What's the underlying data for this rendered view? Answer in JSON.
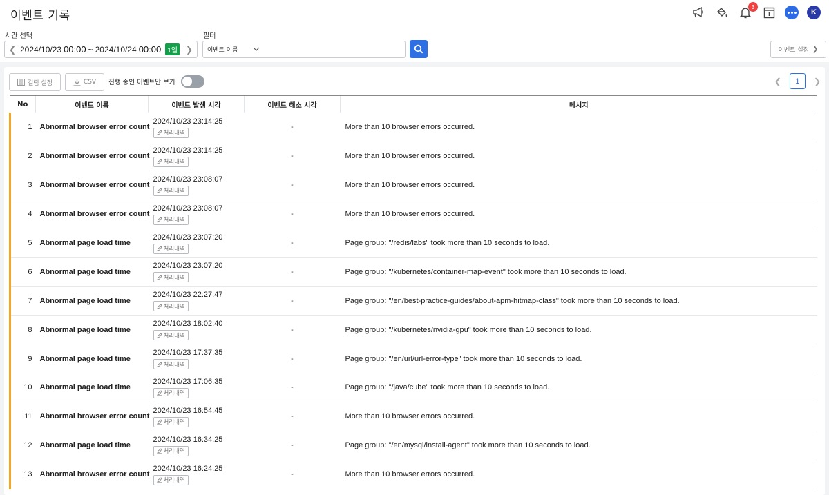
{
  "header": {
    "title": "이벤트 기록",
    "notification_count": "3",
    "avatar_letter": "K"
  },
  "filters": {
    "time_label": "시간 선택",
    "time_from_date": "2024/10/23",
    "time_from_clock": "00:00",
    "time_sep": "~",
    "time_to_date": "2024/10/24",
    "time_to_clock": "00:00",
    "time_range_badge": "1일",
    "filter_label": "필터",
    "filter_select": "이벤트 이름",
    "filter_value": "",
    "event_settings": "이벤트 설정"
  },
  "toolbar": {
    "column_settings": "컬럼 설정",
    "csv": "CSV",
    "ongoing_only": "진행 중인 이벤트만 보기",
    "ongoing_toggle_on": false
  },
  "pagination": {
    "current_page": "1"
  },
  "table": {
    "columns": [
      "No",
      "이벤트 이름",
      "이벤트 발생 시각",
      "이벤트 해소 시각",
      "메시지"
    ],
    "history_button": "처리내역",
    "rows": [
      {
        "no": "1",
        "name": "Abnormal browser error count",
        "occurred": "2024/10/23 23:14:25",
        "resolved": "-",
        "message": "More than 10 browser errors occurred."
      },
      {
        "no": "2",
        "name": "Abnormal browser error count",
        "occurred": "2024/10/23 23:14:25",
        "resolved": "-",
        "message": "More than 10 browser errors occurred."
      },
      {
        "no": "3",
        "name": "Abnormal browser error count",
        "occurred": "2024/10/23 23:08:07",
        "resolved": "-",
        "message": "More than 10 browser errors occurred."
      },
      {
        "no": "4",
        "name": "Abnormal browser error count",
        "occurred": "2024/10/23 23:08:07",
        "resolved": "-",
        "message": "More than 10 browser errors occurred."
      },
      {
        "no": "5",
        "name": "Abnormal page load time",
        "occurred": "2024/10/23 23:07:20",
        "resolved": "-",
        "message": "Page group: \"/redis/labs\" took more than 10 seconds to load."
      },
      {
        "no": "6",
        "name": "Abnormal page load time",
        "occurred": "2024/10/23 23:07:20",
        "resolved": "-",
        "message": "Page group: \"/kubernetes/container-map-event\" took more than 10 seconds to load."
      },
      {
        "no": "7",
        "name": "Abnormal page load time",
        "occurred": "2024/10/23 22:27:47",
        "resolved": "-",
        "message": "Page group: \"/en/best-practice-guides/about-apm-hitmap-class\" took more than 10 seconds to load."
      },
      {
        "no": "8",
        "name": "Abnormal page load time",
        "occurred": "2024/10/23 18:02:40",
        "resolved": "-",
        "message": "Page group: \"/kubernetes/nvidia-gpu\" took more than 10 seconds to load."
      },
      {
        "no": "9",
        "name": "Abnormal page load time",
        "occurred": "2024/10/23 17:37:35",
        "resolved": "-",
        "message": "Page group: \"/en/url/url-error-type\" took more than 10 seconds to load."
      },
      {
        "no": "10",
        "name": "Abnormal page load time",
        "occurred": "2024/10/23 17:06:35",
        "resolved": "-",
        "message": "Page group: \"/java/cube\" took more than 10 seconds to load."
      },
      {
        "no": "11",
        "name": "Abnormal browser error count",
        "occurred": "2024/10/23 16:54:45",
        "resolved": "-",
        "message": "More than 10 browser errors occurred."
      },
      {
        "no": "12",
        "name": "Abnormal page load time",
        "occurred": "2024/10/23 16:34:25",
        "resolved": "-",
        "message": "Page group: \"/en/mysql/install-agent\" took more than 10 seconds to load."
      },
      {
        "no": "13",
        "name": "Abnormal browser error count",
        "occurred": "2024/10/23 16:24:25",
        "resolved": "-",
        "message": "More than 10 browser errors occurred."
      }
    ]
  }
}
